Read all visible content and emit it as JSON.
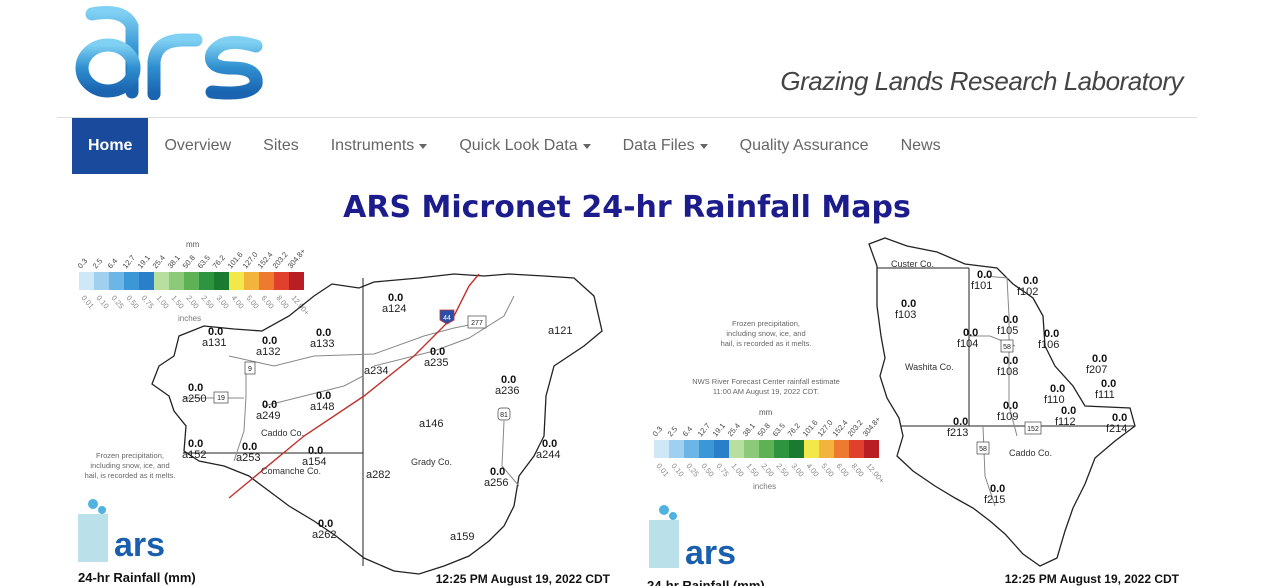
{
  "brand": {
    "logo_text": "ars"
  },
  "header": {
    "lab_title": "Grazing Lands Research Laboratory"
  },
  "nav": {
    "items": [
      {
        "label": "Home",
        "active": true,
        "dropdown": false
      },
      {
        "label": "Overview",
        "active": false,
        "dropdown": false
      },
      {
        "label": "Sites",
        "active": false,
        "dropdown": false
      },
      {
        "label": "Instruments",
        "active": false,
        "dropdown": true
      },
      {
        "label": "Quick Look Data",
        "active": false,
        "dropdown": true
      },
      {
        "label": "Data Files",
        "active": false,
        "dropdown": true
      },
      {
        "label": "Quality Assurance",
        "active": false,
        "dropdown": false
      },
      {
        "label": "News",
        "active": false,
        "dropdown": false
      }
    ]
  },
  "page": {
    "heading": "ARS Micronet 24-hr Rainfall Maps"
  },
  "legend": {
    "unit_mm": "mm",
    "unit_in": "inches",
    "mm_ticks": [
      "0.3",
      "2.5",
      "6.4",
      "12.7",
      "19.1",
      "25.4",
      "38.1",
      "50.8",
      "63.5",
      "76.2",
      "101.6",
      "127.0",
      "152.4",
      "203.2",
      "304.8+"
    ],
    "in_ticks": [
      "0.01",
      "0.10",
      "0.25",
      "0.50",
      "0.75",
      "1.00",
      "1.50",
      "2.00",
      "2.50",
      "3.00",
      "4.00",
      "5.00",
      "6.00",
      "8.00",
      "12.00+"
    ],
    "colors": [
      "#cfe8f7",
      "#9fd0ef",
      "#6bb6e6",
      "#3d97d6",
      "#2a7fc8",
      "#b8dfa0",
      "#8cc97a",
      "#5fb155",
      "#2e9440",
      "#1a7a30",
      "#f2e84a",
      "#f2b43c",
      "#ee7a30",
      "#e0402c",
      "#b81e24"
    ]
  },
  "map_left": {
    "note": [
      "Frozen precipitation,",
      "including snow, ice, and",
      "hail, is recorded as it melts."
    ],
    "counties": [
      "Caddo Co.",
      "Comanche Co.",
      "Grady Co."
    ],
    "highways": [
      "9",
      "19",
      "44",
      "277",
      "81"
    ],
    "stations": [
      {
        "id": "a124",
        "value": "0.0"
      },
      {
        "id": "a121",
        "value": ""
      },
      {
        "id": "a131",
        "value": "0.0"
      },
      {
        "id": "a132",
        "value": "0.0"
      },
      {
        "id": "a133",
        "value": "0.0"
      },
      {
        "id": "a235",
        "value": "0.0"
      },
      {
        "id": "a234",
        "value": ""
      },
      {
        "id": "a236",
        "value": "0.0"
      },
      {
        "id": "a250",
        "value": "0.0"
      },
      {
        "id": "a148",
        "value": "0.0"
      },
      {
        "id": "a249",
        "value": "0.0"
      },
      {
        "id": "a146",
        "value": ""
      },
      {
        "id": "a152",
        "value": "0.0"
      },
      {
        "id": "a253",
        "value": "0.0"
      },
      {
        "id": "a154",
        "value": "0.0"
      },
      {
        "id": "a282",
        "value": ""
      },
      {
        "id": "a244",
        "value": "0.0"
      },
      {
        "id": "a256",
        "value": "0.0"
      },
      {
        "id": "a262",
        "value": "0.0"
      },
      {
        "id": "a159",
        "value": ""
      }
    ],
    "footer_title": "24-hr Rainfall (mm)",
    "timestamp": "12:25 PM August 19, 2022 CDT"
  },
  "map_right": {
    "note": [
      "Frozen precipitation,",
      "including snow, ice, and",
      "hail, is recorded as it melts."
    ],
    "nws_note": [
      "NWS River Forecast Center rainfall estimate",
      "11:00 AM August 19, 2022 CDT."
    ],
    "counties": [
      "Custer Co.",
      "Washita Co.",
      "Caddo Co."
    ],
    "highways": [
      "58",
      "152",
      "58"
    ],
    "stations": [
      {
        "id": "f101",
        "value": "0.0"
      },
      {
        "id": "f102",
        "value": "0.0"
      },
      {
        "id": "f103",
        "value": "0.0"
      },
      {
        "id": "f104",
        "value": "0.0"
      },
      {
        "id": "f105",
        "value": "0.0"
      },
      {
        "id": "f106",
        "value": "0.0"
      },
      {
        "id": "f108",
        "value": "0.0"
      },
      {
        "id": "f207",
        "value": "0.0"
      },
      {
        "id": "f111",
        "value": "0.0"
      },
      {
        "id": "f110",
        "value": "0.0"
      },
      {
        "id": "f109",
        "value": "0.0"
      },
      {
        "id": "f112",
        "value": "0.0"
      },
      {
        "id": "f213",
        "value": "0.0"
      },
      {
        "id": "f214",
        "value": "0.0"
      },
      {
        "id": "f215",
        "value": "0.0"
      }
    ],
    "footer_title": "24-hr Rainfall (mm)",
    "timestamp": "12:25 PM August 19, 2022 CDT"
  }
}
